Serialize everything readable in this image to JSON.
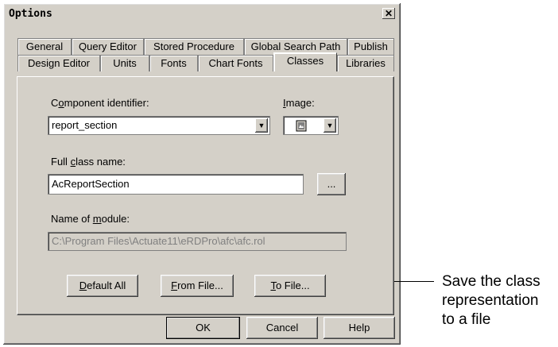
{
  "window": {
    "title": "Options",
    "close_glyph": "✕"
  },
  "tabs_row1": [
    "General",
    "Query Editor",
    "Stored Procedure",
    "Global Search Path",
    "Publish"
  ],
  "tabs_row2": [
    "Design Editor",
    "Units",
    "Fonts",
    "Chart Fonts",
    "Classes",
    "Libraries"
  ],
  "active_tab": "Classes",
  "component": {
    "label_pre": "C",
    "label_u": "o",
    "label_post": "mponent identifier:",
    "value": "report_section"
  },
  "image": {
    "label_u": "I",
    "label_post": "mage:",
    "icon": "component-image-icon"
  },
  "fullclass": {
    "label_pre": "Full ",
    "label_u": "c",
    "label_post": "lass name:",
    "value": "AcReportSection",
    "browse_label": "..."
  },
  "module": {
    "label_pre": "Name of ",
    "label_u": "m",
    "label_post": "odule:",
    "value": "C:\\Program Files\\Actuate11\\eRDPro\\afc\\afc.rol"
  },
  "buttons": {
    "default_all_u": "D",
    "default_all_post": "efault All",
    "from_file_u": "F",
    "from_file_post": "rom File...",
    "to_file_u": "T",
    "to_file_post": "o File...",
    "ok": "OK",
    "cancel": "Cancel",
    "help": "Help"
  },
  "annotation": {
    "lines": [
      "Save the class",
      "representation",
      "to a file"
    ]
  }
}
